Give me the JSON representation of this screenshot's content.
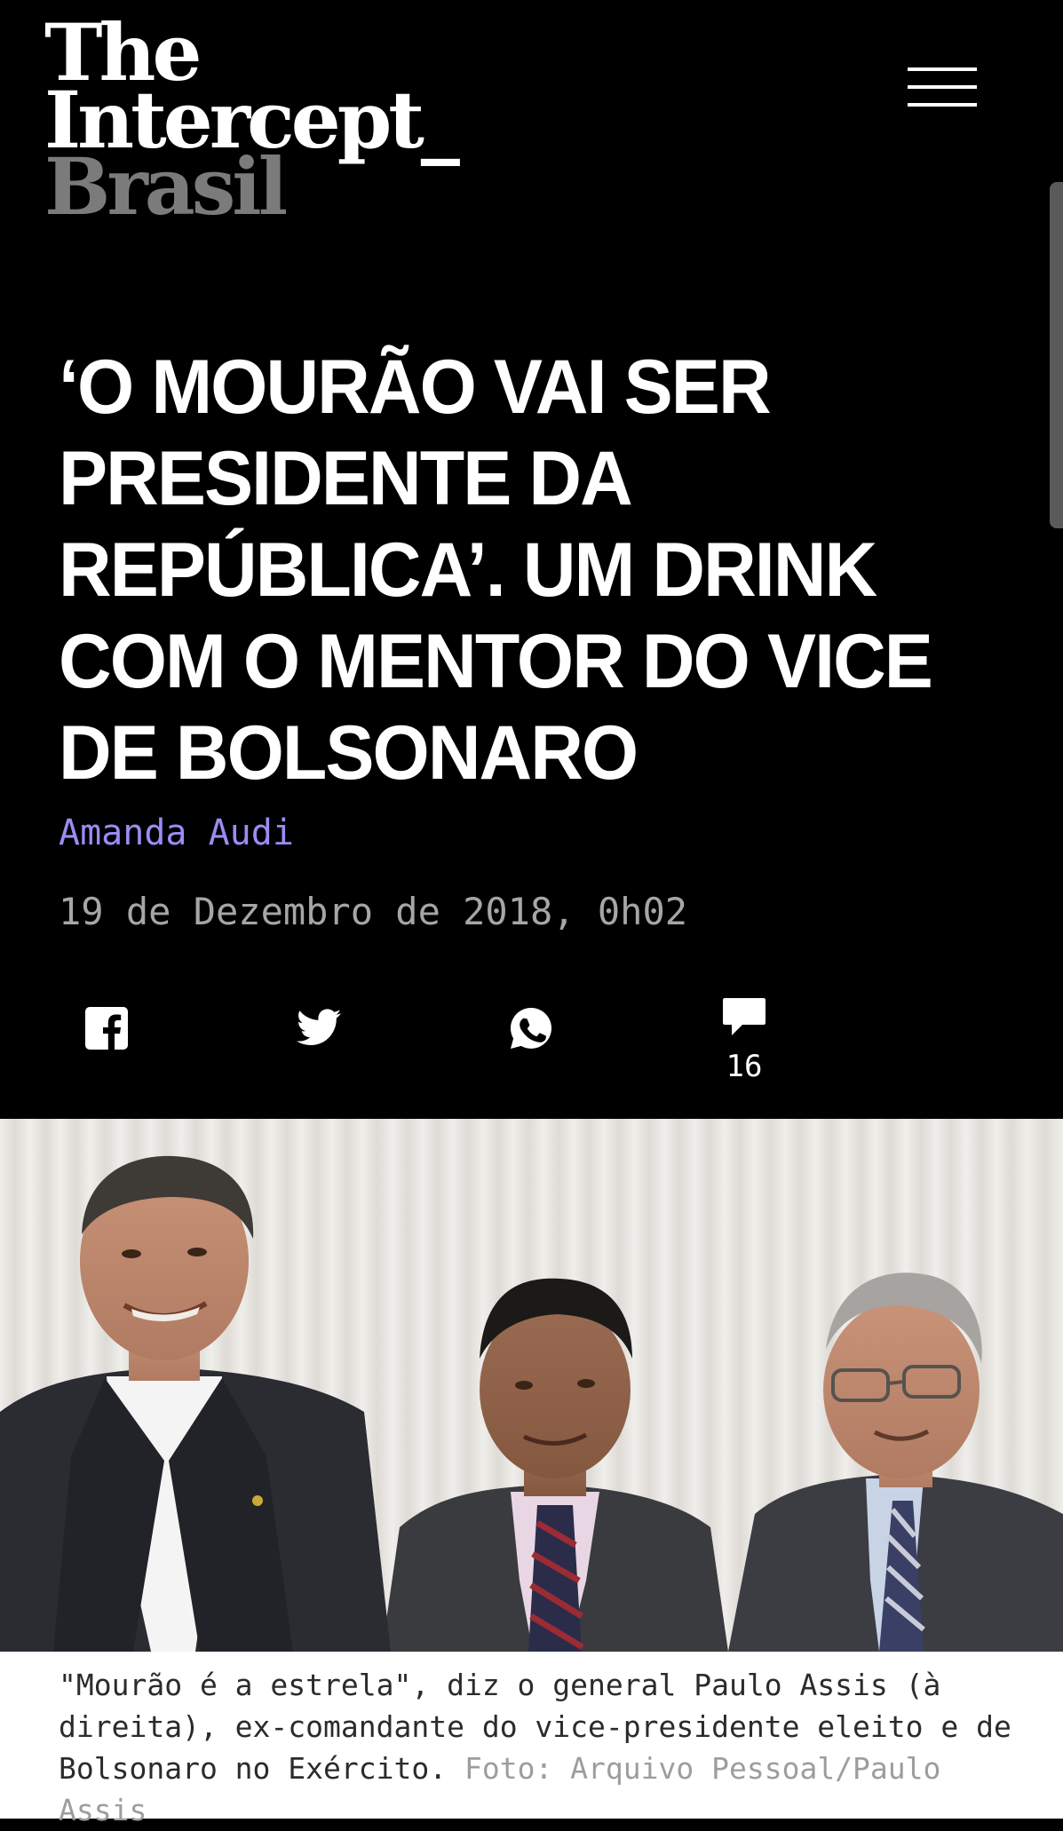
{
  "brand": {
    "logo_line1": "The",
    "logo_line2": "Intercept_",
    "logo_line3": "Brasil"
  },
  "header": {
    "menu_icon": "hamburger-menu-icon"
  },
  "article": {
    "title": "‘O MOURÃO VAI SER PRESIDENTE DA REPÚBLICA’. UM DRINK COM O MENTOR DO VICE DE BOLSONARO",
    "author": "Amanda Audi",
    "date": "19 de Dezembro de 2018, 0h02"
  },
  "share": {
    "icons": [
      "facebook-icon",
      "twitter-icon",
      "whatsapp-icon",
      "comment-icon"
    ],
    "comment_count": "16"
  },
  "photo": {
    "caption": "\"Mourão é a estrela\", diz o general Paulo Assis (à direita), ex-comandante do vice-presidente eleito e de Bolsonaro no Exército.",
    "credit": "Foto: Arquivo Pessoal/Paulo Assis"
  },
  "colors": {
    "background": "#000000",
    "text": "#ffffff",
    "author_link": "#9b8cf2",
    "date": "#a6a6a6",
    "logo_secondary": "#7b7b7b"
  }
}
